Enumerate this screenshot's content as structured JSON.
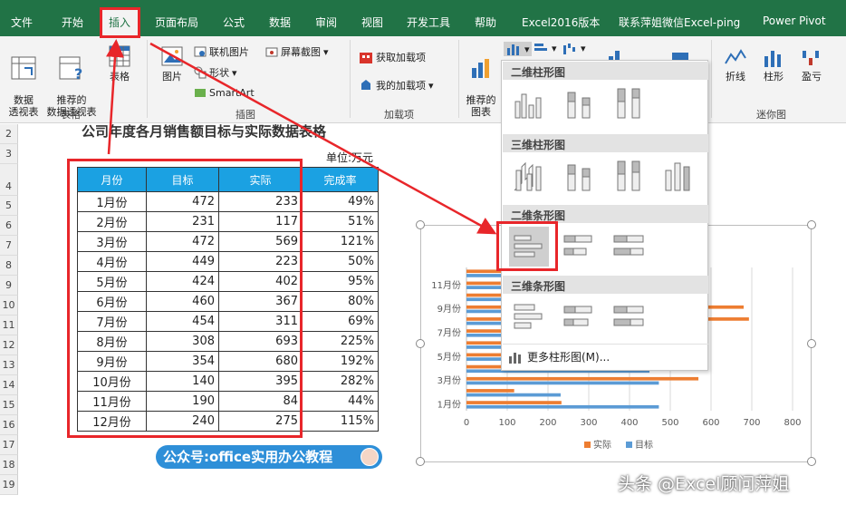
{
  "ribbon_tabs": [
    "文件",
    "开始",
    "插入",
    "页面布局",
    "公式",
    "数据",
    "审阅",
    "视图",
    "开发工具",
    "帮助",
    "Excel2016版本",
    "联系萍姐微信Excel-ping",
    "Power Pivot"
  ],
  "active_tab": "插入",
  "ribbon": {
    "pivot_label": "数据\n透视表",
    "recommended_pivot_label": "推荐的\n数据透视表",
    "table_label": "表格",
    "tables_group": "表格",
    "picture_label": "图片",
    "online_pictures": "联机图片",
    "shapes": "形状",
    "smartart": "SmartArt",
    "screenshot": "屏幕截图",
    "illustrations_group": "插图",
    "get_addins": "获取加载项",
    "my_addins": "我的加载项",
    "addins_group": "加载项",
    "recommended_charts": "推荐的\n图表",
    "spark_line": "折线",
    "spark_column": "柱形",
    "spark_winloss": "盈亏",
    "sparklines_group": "迷你图"
  },
  "sheet": {
    "row_numbers": [
      "2",
      "3",
      "4",
      "5",
      "6",
      "7",
      "8",
      "9",
      "10",
      "11",
      "12",
      "13",
      "14",
      "15",
      "16",
      "17",
      "18",
      "19"
    ],
    "title": "公司年度各月销售额目标与实际数据表格",
    "unit": "单位:万元",
    "headers": [
      "月份",
      "目标",
      "实际",
      "完成率"
    ],
    "rows": [
      [
        "1月份",
        "472",
        "233",
        "49%"
      ],
      [
        "2月份",
        "231",
        "117",
        "51%"
      ],
      [
        "3月份",
        "472",
        "569",
        "121%"
      ],
      [
        "4月份",
        "449",
        "223",
        "50%"
      ],
      [
        "5月份",
        "424",
        "402",
        "95%"
      ],
      [
        "6月份",
        "460",
        "367",
        "80%"
      ],
      [
        "7月份",
        "454",
        "311",
        "69%"
      ],
      [
        "8月份",
        "308",
        "693",
        "225%"
      ],
      [
        "9月份",
        "354",
        "680",
        "192%"
      ],
      [
        "10月份",
        "140",
        "395",
        "282%"
      ],
      [
        "11月份",
        "190",
        "84",
        "44%"
      ],
      [
        "12月份",
        "240",
        "275",
        "115%"
      ]
    ],
    "wechat_label": "公众号:office实用办公教程"
  },
  "chart_data": {
    "type": "bar",
    "orientation": "horizontal",
    "categories": [
      "1月份",
      "2月份",
      "3月份",
      "4月份",
      "5月份",
      "6月份",
      "7月份",
      "8月份",
      "9月份",
      "10月份",
      "11月份",
      "12月份"
    ],
    "tick_labels_y": [
      "1月份",
      "3月份",
      "5月份",
      "7月份",
      "9月份",
      "11月份"
    ],
    "series": [
      {
        "name": "实际",
        "color": "#ed7d31",
        "values": [
          233,
          117,
          569,
          223,
          402,
          367,
          311,
          693,
          680,
          395,
          84,
          275
        ]
      },
      {
        "name": "目标",
        "color": "#5b9bd5",
        "values": [
          472,
          231,
          472,
          449,
          424,
          460,
          454,
          308,
          354,
          140,
          190,
          240
        ]
      }
    ],
    "xlim": [
      0,
      800
    ],
    "x_ticks": [
      "0",
      "100",
      "200",
      "300",
      "400",
      "500",
      "600",
      "700",
      "800"
    ],
    "grid": true,
    "legend": "bottom"
  },
  "dropdown": {
    "sections": [
      "二维柱形图",
      "三维柱形图",
      "二维条形图",
      "三维条形图"
    ],
    "more_label": "更多柱形图(M)..."
  },
  "watermark": "头条 @Excel顾问萍姐"
}
